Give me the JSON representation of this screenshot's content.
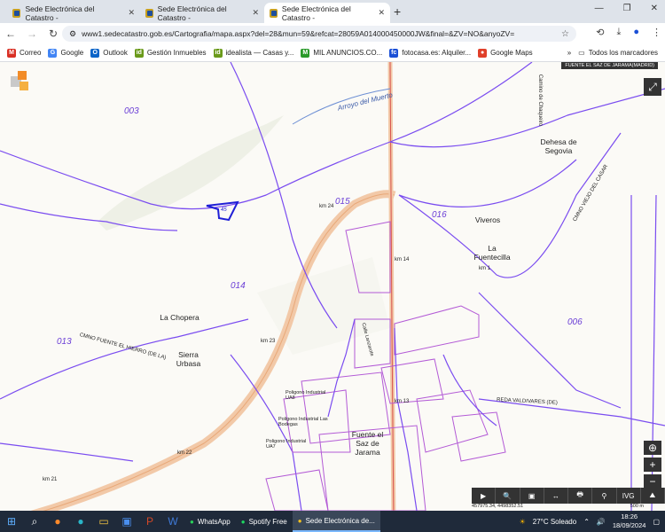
{
  "tabs": [
    {
      "label": "Sede Electrónica del Catastro -",
      "active": false
    },
    {
      "label": "Sede Electrónica del Catastro -",
      "active": false
    },
    {
      "label": "Sede Electrónica del Catastro -",
      "active": true
    }
  ],
  "url": "www1.sedecatastro.gob.es/Cartografia/mapa.aspx?del=28&mun=59&refcat=28059A014000450000JW&final=&ZV=NO&anyoZV=",
  "bookmarks": [
    {
      "label": "Correo",
      "icon": "gmail-icon",
      "color": "#d93025"
    },
    {
      "label": "Google",
      "icon": "google-icon",
      "color": "#4285f4"
    },
    {
      "label": "Outlook",
      "icon": "outlook-icon",
      "color": "#0a64c8"
    },
    {
      "label": "Gestión Inmuebles",
      "icon": "id-icon",
      "color": "#6a9a1a"
    },
    {
      "label": "idealista — Casas y...",
      "icon": "id-icon",
      "color": "#6a9a1a"
    },
    {
      "label": "MIL ANUNCIOS.CO...",
      "icon": "mil-icon",
      "color": "#2a9a2a"
    },
    {
      "label": "fotocasa.es: Alquiler...",
      "icon": "fc-icon",
      "color": "#1a4fd6"
    },
    {
      "label": "Google Maps",
      "icon": "maps-pin-icon",
      "color": "#e0402a"
    }
  ],
  "all_bookmarks": "Todos los marcadores",
  "map": {
    "top_tag": "FUENTE EL SAZ DE JARAMA(MADRID)",
    "parcels": [
      {
        "label": "003"
      },
      {
        "label": "015"
      },
      {
        "label": "016"
      },
      {
        "label": "014"
      },
      {
        "label": "013"
      },
      {
        "label": "006"
      }
    ],
    "places": [
      {
        "label": "Dehesa de Segovia"
      },
      {
        "label": "Viveros"
      },
      {
        "label": "La Fuentecilla"
      },
      {
        "label": "La Chopera"
      },
      {
        "label": "Sierra Urbasa"
      },
      {
        "label": "Fuente el Saz de Jarama"
      }
    ],
    "roads": [
      {
        "label": "Arroyo del Muerto"
      },
      {
        "label": "Camino de Chaqueiro"
      },
      {
        "label": "CMNO VIEJO DEL CASAR"
      },
      {
        "label": "CMNO FUENTE EL HIERRO (DE LA)"
      },
      {
        "label": "km 24"
      },
      {
        "label": "km 14"
      },
      {
        "label": "km 23"
      },
      {
        "label": "km 22"
      },
      {
        "label": "km 21"
      },
      {
        "label": "km 13"
      },
      {
        "label": "km 1"
      },
      {
        "label": "REDA VALDIVARES (DE)"
      },
      {
        "label": "Poligono Industrial UA8"
      },
      {
        "label": "Poligono Industrial Las Bodegas"
      },
      {
        "label": "Poligono Industrial UA7"
      },
      {
        "label": "Calle Lanzarote"
      }
    ],
    "selected_parcel": "45",
    "coords": "457975.34, 4498352.51",
    "scale": "500 m",
    "tools": [
      "▶",
      "🔍",
      "▣",
      "↔",
      "🖶",
      "⚲",
      "IVG",
      "⛰"
    ]
  },
  "taskbar": {
    "apps": [
      {
        "label": "WhatsApp",
        "active": false
      },
      {
        "label": "Spotify Free",
        "active": false
      },
      {
        "label": "Sede Electrónica de...",
        "active": true
      }
    ],
    "weather": "27°C  Soleado",
    "time": "18:26",
    "date": "18/09/2024"
  }
}
